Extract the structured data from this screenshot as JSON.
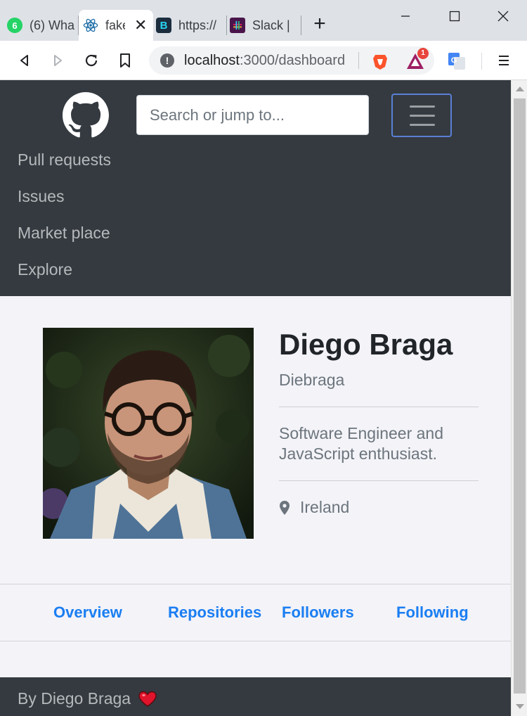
{
  "browser": {
    "tabs": [
      {
        "title": "(6) Wha",
        "icon": "whatsapp-icon",
        "badge": "6"
      },
      {
        "title": "fake",
        "icon": "react-icon",
        "active": true
      },
      {
        "title": "https://",
        "icon": "bonsai-icon"
      },
      {
        "title": "Slack |",
        "icon": "slack-icon"
      }
    ],
    "url_host": "localhost",
    "url_path": ":3000/dashboard",
    "extension_badge": "1"
  },
  "header": {
    "search_placeholder": "Search or jump to...",
    "nav": [
      "Pull requests",
      "Issues",
      "Market place",
      "Explore"
    ]
  },
  "profile": {
    "name": "Diego Braga",
    "login": "Diebraga",
    "bio": "Software Engineer and JavaScript enthusiast.",
    "location": "Ireland"
  },
  "profile_tabs": [
    "Overview",
    "Repositories",
    "Followers",
    "Following"
  ],
  "footer": {
    "text": "By Diego Braga"
  },
  "colors": {
    "header_bg": "#343a40",
    "page_bg": "#f3f3f8",
    "link": "#1a7ef2"
  }
}
